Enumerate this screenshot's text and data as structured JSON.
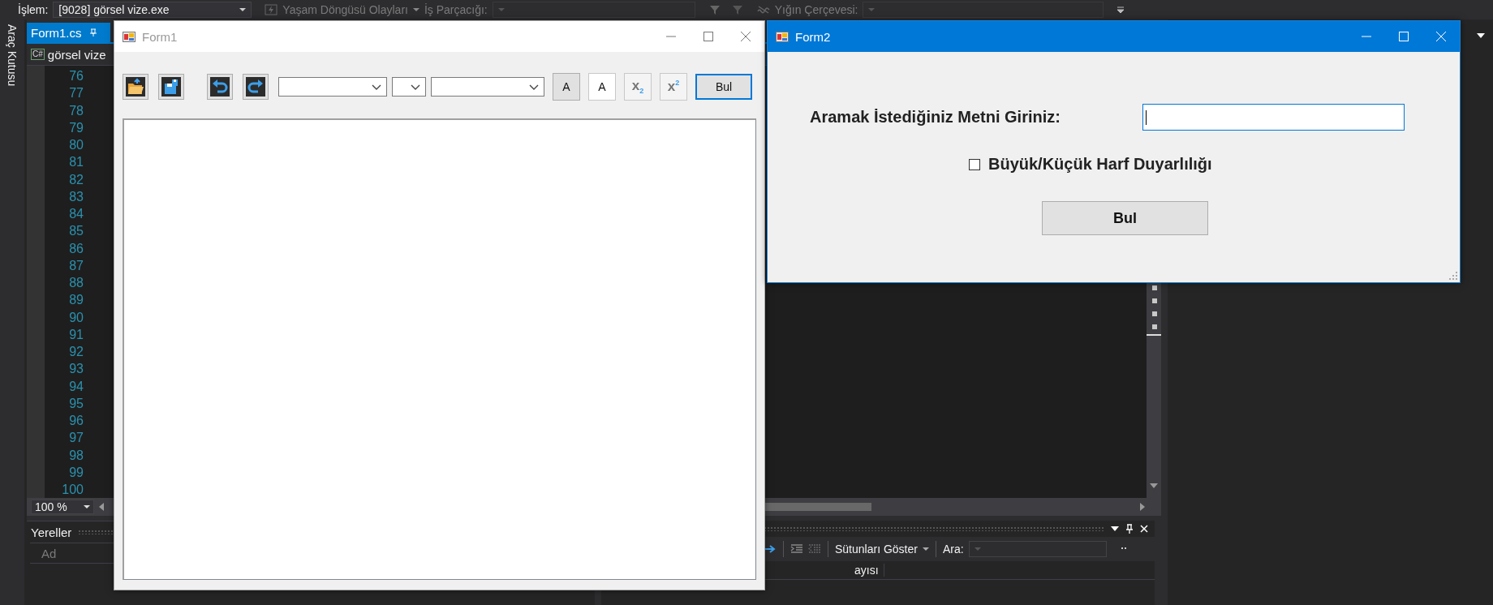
{
  "ide": {
    "toolbar": {
      "process_label": "İşlem:",
      "process_value": "[9028] görsel vize.exe",
      "lifecycle_label": "Yaşam Döngüsü Olayları",
      "thread_label": "İş Parçacığı:",
      "stack_label": "Yığın Çerçevesi:"
    },
    "toolbox_tab": "Araç Kutusu",
    "editor": {
      "tab": "Form1.cs",
      "file_badge": "C#",
      "project": "görsel vize",
      "line_numbers": [
        "76",
        "77",
        "78",
        "79",
        "80",
        "81",
        "82",
        "83",
        "84",
        "85",
        "86",
        "87",
        "88",
        "89",
        "90",
        "91",
        "92",
        "93",
        "94",
        "95",
        "96",
        "97",
        "98",
        "99",
        "100"
      ],
      "zoom": "100 %"
    },
    "locals": {
      "title": "Yereller",
      "column": "Ad"
    },
    "bottom_panel": {
      "show_columns": "Sütunları Göster",
      "search_label": "Ara:",
      "column_fragment": "ayısı"
    }
  },
  "form1": {
    "title": "Form1",
    "active": false,
    "format_buttons": [
      {
        "label": "A",
        "pressed": true
      },
      {
        "label": "A",
        "pressed": false
      },
      {
        "label": "x$_{2}$",
        "pressed": false
      },
      {
        "label": "x$^{2}$",
        "pressed": false
      }
    ],
    "find_button": "Bul"
  },
  "form2": {
    "title": "Form2",
    "active": true,
    "search_label": "Aramak İstediğiniz Metni Giriniz:",
    "case_sensitive": {
      "label": "Büyük/Küçük Harf Duyarlılığı",
      "checked": false
    },
    "find_button": "Bul"
  }
}
